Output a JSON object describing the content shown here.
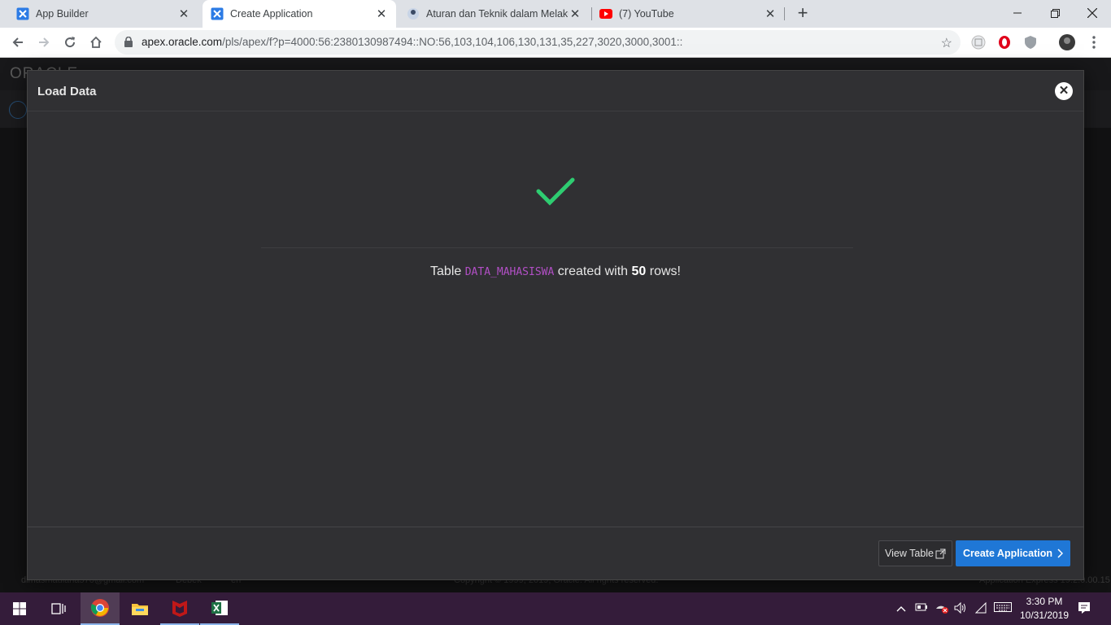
{
  "browser": {
    "tabs": [
      {
        "title": "App Builder",
        "favicon": "apex-icon",
        "active": false
      },
      {
        "title": "Create Application",
        "favicon": "apex-icon",
        "active": true
      },
      {
        "title": "Aturan dan Teknik dalam Melaku",
        "favicon": "avatar-icon",
        "active": false
      },
      {
        "title": "(7) YouTube",
        "favicon": "youtube-icon",
        "active": false
      }
    ],
    "url_host": "apex.oracle.com",
    "url_path": "/pls/apex/f?p=4000:56:2380130987494::NO:56,103,104,106,130,131,35,227,3020,3000,3001::"
  },
  "apex": {
    "logo_text": "ORACLE",
    "footer_user": "dimasmaulana570@gmail.com",
    "footer_ws": "Debek",
    "footer_lang": "en",
    "footer_copyright": "Copyright © 1999, 2019, Oracle. All rights reserved.",
    "footer_version": "Application Express 19.2.0.00.15"
  },
  "dialog": {
    "title": "Load Data",
    "message_prefix": "Table",
    "table_name": "DATA_MAHASISWA",
    "message_middle": "created with",
    "row_count": "50",
    "message_suffix": "rows!",
    "view_table_label": "View Table",
    "create_app_label": "Create Application",
    "accent_color": "#1f77d6",
    "success_color": "#2ecc71"
  },
  "taskbar": {
    "time": "3:30 PM",
    "date": "10/31/2019"
  }
}
